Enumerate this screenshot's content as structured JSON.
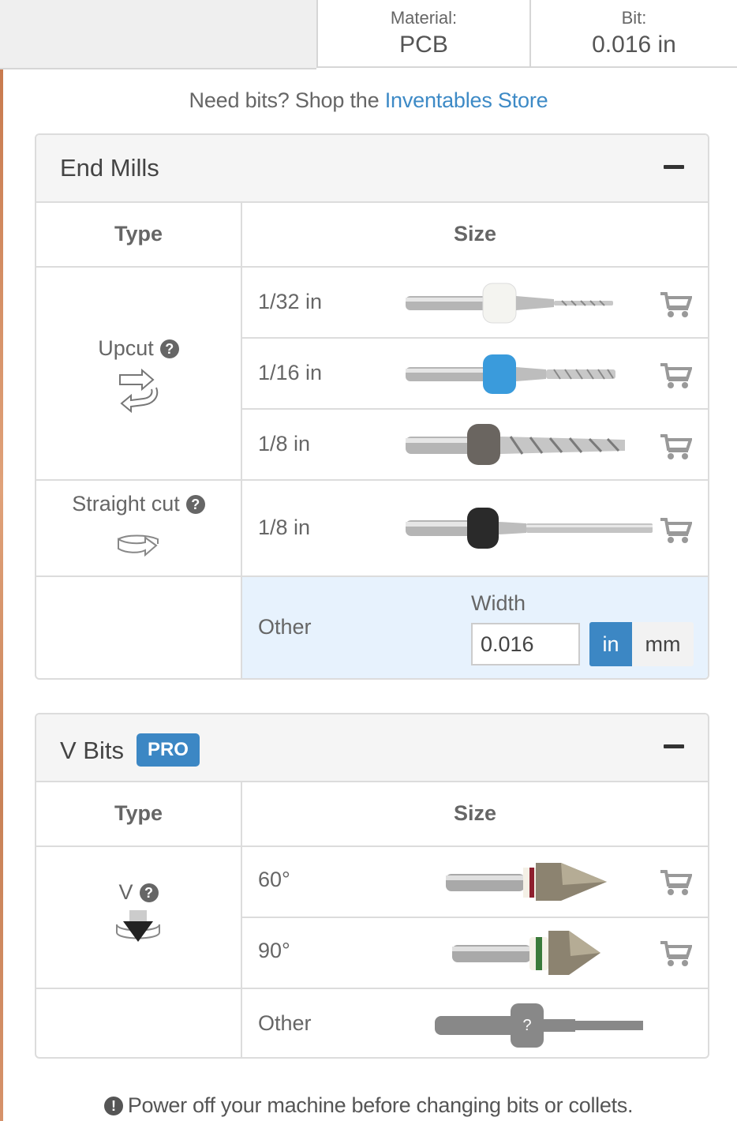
{
  "header": {
    "material_label": "Material:",
    "material_value": "PCB",
    "bit_label": "Bit:",
    "bit_value": "0.016 in"
  },
  "shop": {
    "prefix": "Need bits? Shop the",
    "link": "Inventables Store"
  },
  "end_mills": {
    "title": "End Mills",
    "col_type": "Type",
    "col_size": "Size",
    "upcut": {
      "label": "Upcut",
      "sizes": [
        "1/32 in",
        "1/16 in",
        "1/8 in"
      ]
    },
    "straight": {
      "label": "Straight cut",
      "sizes": [
        "1/8 in"
      ]
    },
    "other": {
      "label": "Other",
      "width_label": "Width",
      "width_value": "0.016",
      "unit_in": "in",
      "unit_mm": "mm"
    }
  },
  "v_bits": {
    "title": "V Bits",
    "badge": "PRO",
    "col_type": "Type",
    "col_size": "Size",
    "v": {
      "label": "V",
      "sizes": [
        "60°",
        "90°"
      ]
    },
    "other_label": "Other",
    "unknown_mark": "?"
  },
  "footer": {
    "text": "Power off your machine before changing bits or collets."
  },
  "colors": {
    "accent": "#3c87c4",
    "link": "#3d8ac6",
    "selected_row": "#e7f2fd",
    "collar_white": "#f4f4f0",
    "collar_blue": "#3a9bdc",
    "collar_gray": "#6a6560",
    "collar_black": "#2a2a2a",
    "vbit_ring_red": "#8e1f2e",
    "vbit_ring_green": "#3a7a3a"
  }
}
